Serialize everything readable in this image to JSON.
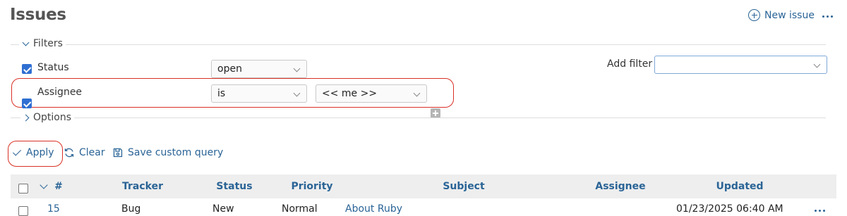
{
  "page": {
    "title": "Issues",
    "new_issue_label": "New issue"
  },
  "filters": {
    "legend": "Filters",
    "status": {
      "label": "Status",
      "checked": true,
      "operator": "open"
    },
    "assignee": {
      "label": "Assignee",
      "checked": true,
      "operator": "is",
      "value": "<< me >>"
    },
    "add_filter_label": "Add filter",
    "add_filter_value": ""
  },
  "options": {
    "legend": "Options"
  },
  "actions": {
    "apply": "Apply",
    "clear": "Clear",
    "save": "Save custom query"
  },
  "table": {
    "headers": {
      "id": "#",
      "tracker": "Tracker",
      "status": "Status",
      "priority": "Priority",
      "subject": "Subject",
      "assignee": "Assignee",
      "updated": "Updated"
    },
    "rows": [
      {
        "id": "15",
        "tracker": "Bug",
        "status": "New",
        "priority": "Normal",
        "subject": "About Ruby",
        "assignee": "",
        "updated": "01/23/2025 06:40 AM"
      }
    ]
  },
  "colors": {
    "link": "#2a6496",
    "highlight": "#d93025",
    "checkbox": "#2f6fd2"
  }
}
